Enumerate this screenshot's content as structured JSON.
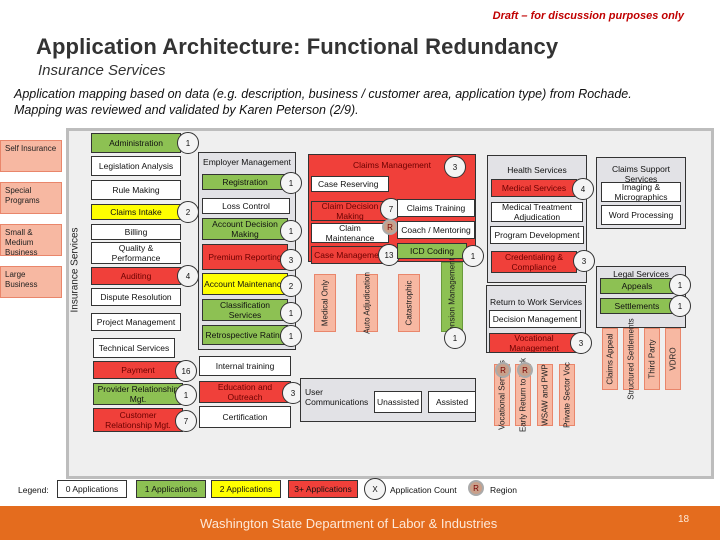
{
  "draft_notice": "Draft – for discussion purposes only",
  "title": "Application Architecture: Functional Redundancy",
  "subtitle": "Insurance Services",
  "description": "Application mapping based on data (e.g. description, business / customer area, application type) from Rochade. Mapping was reviewed and validated by Karen Peterson (2/9).",
  "panel_label": "Insurance Services",
  "segments": [
    "Self Insurance",
    "Special Programs",
    "Small & Medium Business",
    "Large Business"
  ],
  "colors": {
    "zero": "#ffffff",
    "one": "#8dc153",
    "two": "#ffff00",
    "three_plus": "#f0403a",
    "segment": "#f7b8a2",
    "footer": "#e46c1e",
    "draft": "#c00000"
  },
  "left_column": [
    {
      "label": "Administration",
      "level": "one",
      "count": "1"
    },
    {
      "label": "Legislation Analysis",
      "level": "zero"
    },
    {
      "label": "Rule Making",
      "level": "zero"
    },
    {
      "label": "Claims Intake",
      "level": "two",
      "count": "2"
    },
    {
      "label": "Billing",
      "level": "zero"
    },
    {
      "label": "Quality & Performance",
      "level": "zero"
    },
    {
      "label": "Auditing",
      "level": "three_plus",
      "count": "4"
    },
    {
      "label": "Dispute Resolution",
      "level": "zero"
    },
    {
      "label": "Project Management",
      "level": "zero"
    },
    {
      "label": "Technical Services",
      "level": "zero"
    },
    {
      "label": "Payment",
      "level": "three_plus",
      "count": "16"
    },
    {
      "label": "Provider Relationship Mgt.",
      "level": "one",
      "count": "1"
    },
    {
      "label": "Customer Relationship Mgt.",
      "level": "three_plus",
      "count": "7"
    }
  ],
  "employer_management": {
    "title": "Employer Management",
    "items": [
      {
        "label": "Registration",
        "level": "one",
        "count": "1"
      },
      {
        "label": "Loss Control",
        "level": "zero"
      },
      {
        "label": "Account Decision Making",
        "level": "one",
        "count": "1"
      },
      {
        "label": "Premium Reporting",
        "level": "three_plus",
        "count": "3"
      },
      {
        "label": "Account Maintenance",
        "level": "two",
        "count": "2"
      },
      {
        "label": "Classification Services",
        "level": "one",
        "count": "1"
      },
      {
        "label": "Retrospective Rating",
        "level": "one",
        "count": "1"
      }
    ]
  },
  "training": [
    {
      "label": "Internal training",
      "level": "zero"
    },
    {
      "label": "Education and Outreach",
      "level": "three_plus",
      "count": "3"
    },
    {
      "label": "Certification",
      "level": "zero"
    }
  ],
  "claims_management": {
    "title": "Claims Management",
    "count": "3",
    "items": [
      {
        "label": "Case Reserving",
        "level": "zero"
      },
      {
        "label": "Claim Decision Making",
        "level": "three_plus",
        "count": "7"
      },
      {
        "label": "Claims Training",
        "level": "zero"
      },
      {
        "label": "Claim Maintenance",
        "level": "zero"
      },
      {
        "label": "Coach / Mentoring",
        "level": "zero"
      },
      {
        "label": "Case Management",
        "level": "three_plus",
        "count": "13"
      },
      {
        "label": "ICD Coding",
        "level": "one",
        "count": "1"
      }
    ],
    "region_marker": "R",
    "subtypes": [
      "Medical Only",
      "Auto Adjudication",
      "Catastrophic",
      "Pension Management"
    ],
    "pension_count": "1"
  },
  "user_communications": {
    "title": "User Communications",
    "items": [
      "Unassisted",
      "Assisted"
    ]
  },
  "health_services": {
    "title": "Health Services",
    "items": [
      {
        "label": "Medical Services",
        "level": "three_plus",
        "count": "4"
      },
      {
        "label": "Medical Treatment Adjudication",
        "level": "zero"
      },
      {
        "label": "Program Development",
        "level": "zero"
      },
      {
        "label": "Credentialing & Compliance",
        "level": "three_plus",
        "count": "3"
      }
    ]
  },
  "return_to_work": {
    "title": "Return to Work Services",
    "items": [
      {
        "label": "Decision Management",
        "level": "zero"
      },
      {
        "label": "Vocational Management",
        "level": "three_plus",
        "count": "3"
      }
    ],
    "subtypes": [
      "Vocational Services",
      "Early Return to Work",
      "WSAW and PWP",
      "Private Sector Voc"
    ],
    "region_markers": [
      "R",
      "R"
    ]
  },
  "claims_support": {
    "title": "Claims Support Services",
    "items": [
      "Imaging & Micrographics",
      "Word Processing"
    ]
  },
  "legal_services": {
    "title": "Legal Services",
    "items": [
      {
        "label": "Appeals",
        "level": "one",
        "count": "1"
      },
      {
        "label": "Settlements",
        "level": "one",
        "count": "1"
      }
    ],
    "subtypes": [
      "Claims Appeal",
      "Structured Settlements",
      "Third Party",
      "VDRO"
    ]
  },
  "legend": {
    "label": "Legend:",
    "items": [
      "0 Applications",
      "1 Applications",
      "2 Applications",
      "3+ Applications"
    ],
    "count_symbol": "X",
    "count_label": "Application Count",
    "region_symbol": "R",
    "region_label": "Region"
  },
  "footer": {
    "org": "Washington State Department of Labor & Industries",
    "page": "18"
  }
}
